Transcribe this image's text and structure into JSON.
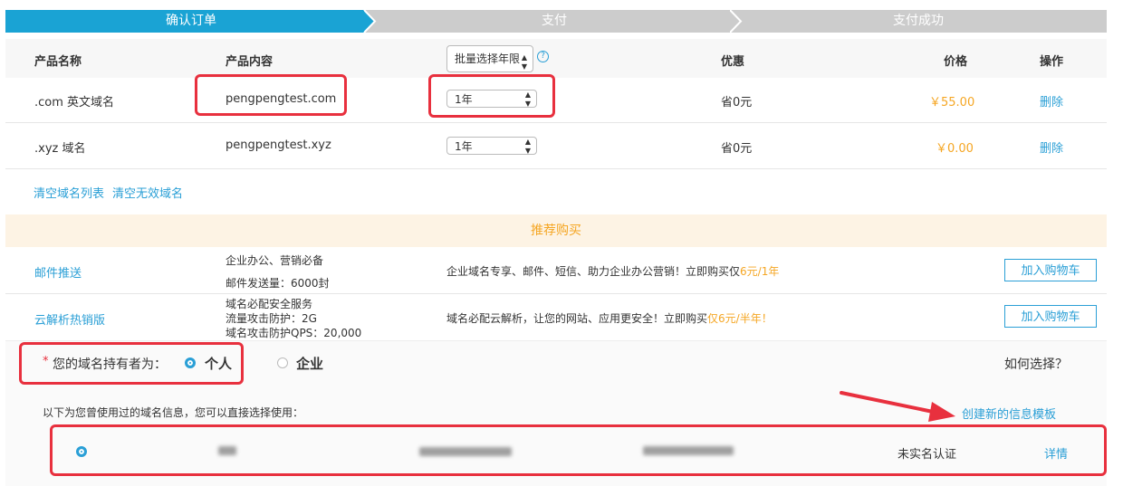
{
  "steps": [
    {
      "label": "确认订单",
      "active": true
    },
    {
      "label": "支付",
      "active": false
    },
    {
      "label": "支付成功",
      "active": false
    }
  ],
  "table": {
    "headers": {
      "name": "产品名称",
      "content": "产品内容",
      "batch_select": "批量选择年限",
      "discount": "优惠",
      "price": "价格",
      "action": "操作"
    },
    "rows": [
      {
        "name": ".com 英文域名",
        "content": "pengpengtest.com",
        "years": "1年",
        "discount": "省0元",
        "price": "￥55.00",
        "action": "删除"
      },
      {
        "name": ".xyz 域名",
        "content": "pengpengtest.xyz",
        "years": "1年",
        "discount": "省0元",
        "price": "￥0.00",
        "action": "删除"
      }
    ],
    "clear_list": "清空域名列表",
    "clear_invalid": "清空无效域名"
  },
  "recommend": {
    "title": "推荐购买",
    "items": [
      {
        "name": "邮件推送",
        "desc_lines": [
          "企业办公、营销必备",
          "邮件发送量：6000封"
        ],
        "promo": "企业域名专享、邮件、短信、助力企业办公营销！立即购买仅",
        "promo_highlight": "6元/1年",
        "button": "加入购物车"
      },
      {
        "name": "云解析热销版",
        "desc_lines": [
          "域名必配安全服务",
          "流量攻击防护：2G",
          "域名攻击防护QPS：20,000"
        ],
        "promo": "域名必配云解析，让您的网站、应用更安全！立即购买",
        "promo_highlight": "仅6元/半年！",
        "button": "加入购物车"
      }
    ]
  },
  "holder": {
    "required_mark": "*",
    "label": "您的域名持有者为：",
    "options": [
      {
        "label": "个人",
        "selected": true
      },
      {
        "label": "企业",
        "selected": false
      }
    ],
    "how_to_choose": "如何选择？",
    "used_info_hint": "以下为您曾使用过的域名信息，您可以直接选择使用：",
    "create_template": "创建新的信息模板",
    "template_status": "未实名认证",
    "template_details": "详情"
  },
  "colors": {
    "accent": "#2a9fd6",
    "step_active": "#1aa3d4",
    "step_inactive": "#cccccc",
    "price": "#f5a623",
    "highlight_box": "#e8303e"
  }
}
